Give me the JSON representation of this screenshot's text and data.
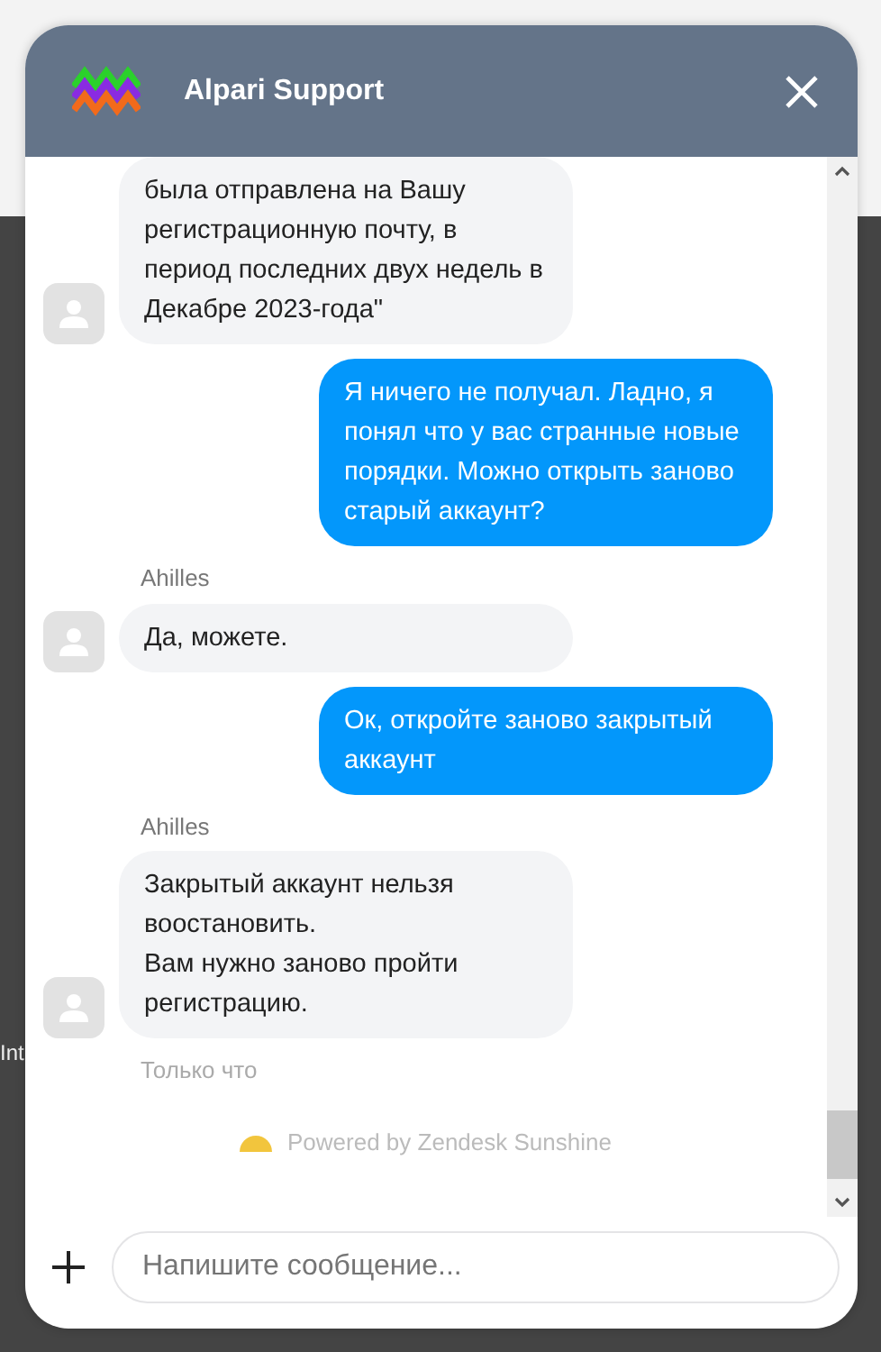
{
  "background_text": "Int",
  "header": {
    "title": "Alpari Support"
  },
  "messages": [
    {
      "kind": "agent",
      "lines": [
        "была отправлена на Вашу регистрационную почту, в период последних двух недель в Декабре 2023-года\""
      ]
    },
    {
      "kind": "user",
      "lines": [
        "Я ничего не получал. Ладно, я понял что у вас странные новые порядки. Можно открыть заново старый аккаунт?"
      ]
    },
    {
      "kind": "sender",
      "text": "Ahilles"
    },
    {
      "kind": "agent",
      "lines": [
        "Да, можете."
      ]
    },
    {
      "kind": "user",
      "lines": [
        "Ок, откройте заново закрытый аккаунт"
      ]
    },
    {
      "kind": "sender",
      "text": "Ahilles"
    },
    {
      "kind": "agent",
      "lines": [
        "Закрытый аккаунт нельзя воостановить.",
        "Вам нужно заново пройти регистрацию."
      ]
    },
    {
      "kind": "time",
      "text": "Только что"
    }
  ],
  "powered_by": "Powered by Zendesk Sunshine",
  "composer": {
    "placeholder": "Напишите сообщение..."
  }
}
